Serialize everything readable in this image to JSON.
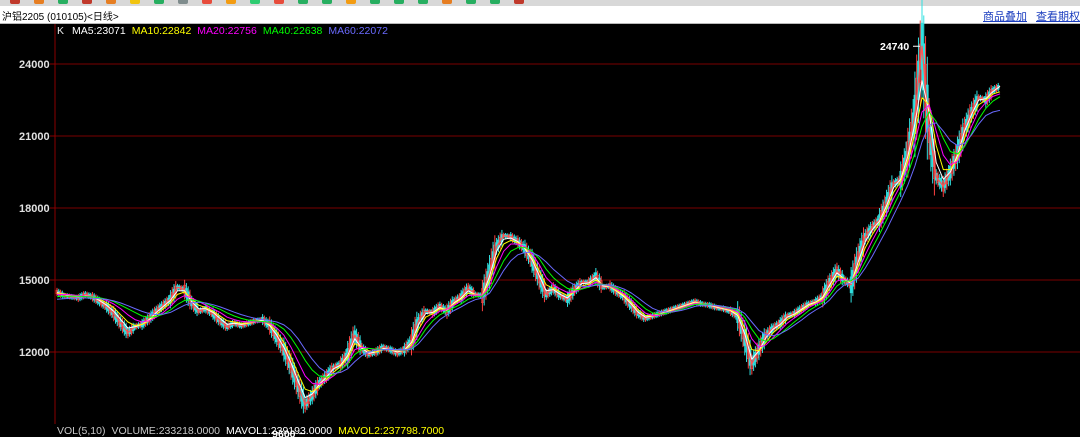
{
  "window": {
    "title": "沪铝2205 (010105)<日线>",
    "links": [
      "商品叠加",
      "查看期权"
    ]
  },
  "toolbar": {
    "icon_colors": [
      "#c0392b",
      "#e67e22",
      "#27ae60",
      "#c0392b",
      "#e67e22",
      "#f1c40f",
      "#27ae60",
      "#7f8c8d",
      "#e74c3c",
      "#f39c12",
      "#2ecc71",
      "#e74c3c",
      "#27ae60",
      "#27ae60",
      "#f39c12",
      "#27ae60",
      "#27ae60",
      "#27ae60",
      "#e67e22",
      "#27ae60",
      "#27ae60",
      "#c0392b"
    ]
  },
  "indicators": {
    "label": "K",
    "items": [
      {
        "text": "MA5:23071",
        "color": "#ffffff"
      },
      {
        "text": "MA10:22842",
        "color": "#ffff00"
      },
      {
        "text": "MA20:22756",
        "color": "#ff00ff"
      },
      {
        "text": "MA40:22638",
        "color": "#00ff00"
      },
      {
        "text": "MA60:22072",
        "color": "#6a6aff"
      }
    ]
  },
  "volume_indicators": {
    "items": [
      {
        "text": "VOL(5,10)",
        "color": "#c8c8c8"
      },
      {
        "text": "VOLUME:233218.0000",
        "color": "#c8c8c8"
      },
      {
        "text": "MAVOL1:239193.0000",
        "color": "#ffffff"
      },
      {
        "text": "MAVOL2:237798.7000",
        "color": "#ffff00"
      }
    ]
  },
  "chart_data": {
    "type": "line",
    "title": "",
    "xlabel": "",
    "ylabel": "",
    "ylim": [
      9000,
      25500
    ],
    "y_ticks": [
      12000,
      15000,
      18000,
      21000,
      24000
    ],
    "y_tick_labels": [
      "12000",
      "15000",
      "18000",
      "21000",
      "24000"
    ],
    "grid": true,
    "annotations": [
      {
        "text": "24740",
        "value": 24740,
        "position": "peak"
      },
      {
        "text": "9600",
        "value": 9600,
        "position": "low"
      }
    ],
    "series": [
      {
        "name": "K",
        "color": "#ff5555",
        "values": [
          14500,
          14350,
          14300,
          14250,
          14400,
          14300,
          14100,
          13900,
          13600,
          13200,
          12800,
          13050,
          13150,
          13400,
          13700,
          13950,
          14200,
          14700,
          14600,
          14050,
          13700,
          13800,
          13600,
          13300,
          13050,
          13200,
          13100,
          13200,
          13300,
          13350,
          13100,
          12600,
          12100,
          11400,
          10600,
          9800,
          10200,
          10700,
          11000,
          11350,
          11500,
          11900,
          12700,
          12150,
          11900,
          12000,
          12200,
          12100,
          11950,
          12100,
          12450,
          13300,
          13700,
          13650,
          13900,
          13700,
          14100,
          14300,
          14650,
          14400,
          14350,
          15300,
          16400,
          16850,
          16800,
          16600,
          16300,
          15800,
          15100,
          14400,
          14650,
          14350,
          14200,
          14600,
          14900,
          14900,
          15150,
          14700,
          14750,
          14500,
          14300,
          13950,
          13600,
          13400,
          13500,
          13600,
          13700,
          13800,
          13900,
          14000,
          14100,
          14000,
          13950,
          13850,
          13800,
          13700,
          13500,
          12600,
          11500,
          12100,
          12700,
          13000,
          13200,
          13500,
          13600,
          13800,
          14000,
          14100,
          14300,
          14900,
          15400,
          15000,
          14800,
          15900,
          16800,
          17200,
          17500,
          18200,
          19000,
          19200,
          20300,
          21900,
          24740,
          21300,
          19300,
          18900,
          19500,
          20300,
          21300,
          22000,
          22600,
          22500,
          22900,
          23071
        ]
      },
      {
        "name": "MA5",
        "color": "#ffffff",
        "values": [
          14480,
          14400,
          14330,
          14300,
          14340,
          14300,
          14150,
          13950,
          13700,
          13350,
          13000,
          13050,
          13150,
          13350,
          13650,
          13900,
          14150,
          14550,
          14550,
          14100,
          13800,
          13800,
          13650,
          13400,
          13150,
          13200,
          13150,
          13200,
          13280,
          13320,
          13100,
          12700,
          12200,
          11550,
          10800,
          10100,
          10250,
          10650,
          10950,
          11300,
          11450,
          11850,
          12550,
          12150,
          11950,
          12000,
          12150,
          12100,
          12000,
          12080,
          12400,
          13150,
          13600,
          13650,
          13850,
          13750,
          14050,
          14250,
          14550,
          14400,
          14350,
          15150,
          16200,
          16700,
          16750,
          16600,
          16300,
          15850,
          15200,
          14550,
          14600,
          14400,
          14250,
          14550,
          14850,
          14880,
          15100,
          14750,
          14720,
          14520,
          14300,
          14000,
          13650,
          13450,
          13500,
          13580,
          13680,
          13780,
          13880,
          13980,
          14080,
          14000,
          13950,
          13870,
          13800,
          13720,
          13520,
          12750,
          11700,
          12050,
          12600,
          12950,
          13150,
          13450,
          13580,
          13780,
          13980,
          14080,
          14280,
          14800,
          15300,
          15050,
          14850,
          15750,
          16600,
          17100,
          17450,
          18100,
          18850,
          19200,
          20150,
          21500,
          23300,
          22000,
          19900,
          19200,
          19500,
          20200,
          21200,
          21900,
          22500,
          22550,
          22850,
          23071
        ]
      },
      {
        "name": "MA10",
        "color": "#ffff00",
        "values": [
          14450,
          14420,
          14370,
          14320,
          14320,
          14300,
          14200,
          14050,
          13850,
          13550,
          13250,
          13100,
          13150,
          13300,
          13550,
          13800,
          14050,
          14400,
          14500,
          14200,
          13950,
          13850,
          13700,
          13500,
          13300,
          13250,
          13200,
          13200,
          13250,
          13280,
          13150,
          12850,
          12400,
          11800,
          11100,
          10450,
          10350,
          10550,
          10850,
          11150,
          11400,
          11750,
          12350,
          12200,
          12050,
          12000,
          12100,
          12100,
          12050,
          12050,
          12300,
          12950,
          13450,
          13600,
          13800,
          13780,
          14000,
          14200,
          14450,
          14400,
          14350,
          14950,
          15900,
          16500,
          16650,
          16550,
          16350,
          15950,
          15400,
          14800,
          14650,
          14500,
          14350,
          14500,
          14750,
          14820,
          15000,
          14800,
          14720,
          14550,
          14350,
          14080,
          13750,
          13520,
          13500,
          13550,
          13650,
          13750,
          13850,
          13950,
          14050,
          14000,
          13960,
          13900,
          13820,
          13750,
          13600,
          13000,
          12100,
          12050,
          12400,
          12800,
          13050,
          13350,
          13520,
          13720,
          13920,
          14050,
          14220,
          14650,
          15150,
          15080,
          14900,
          15550,
          16350,
          16900,
          17350,
          17950,
          18650,
          19100,
          19950,
          21100,
          22600,
          22300,
          20600,
          19600,
          19600,
          20050,
          20900,
          21700,
          22300,
          22500,
          22750,
          22842
        ]
      },
      {
        "name": "MA20",
        "color": "#ff00ff",
        "values": [
          14400,
          14400,
          14380,
          14350,
          14330,
          14300,
          14250,
          14150,
          14000,
          13800,
          13550,
          13350,
          13250,
          13300,
          13450,
          13650,
          13900,
          14200,
          14350,
          14250,
          14100,
          13950,
          13800,
          13650,
          13450,
          13350,
          13280,
          13250,
          13250,
          13260,
          13200,
          13000,
          12700,
          12200,
          11600,
          11000,
          10700,
          10650,
          10800,
          11000,
          11250,
          11550,
          12100,
          12200,
          12150,
          12080,
          12100,
          12100,
          12080,
          12060,
          12200,
          12700,
          13200,
          13500,
          13700,
          13780,
          13950,
          14120,
          14350,
          14380,
          14360,
          14750,
          15550,
          16200,
          16500,
          16500,
          16380,
          16100,
          15650,
          15100,
          14800,
          14620,
          14480,
          14500,
          14650,
          14750,
          14900,
          14820,
          14750,
          14600,
          14420,
          14180,
          13880,
          13620,
          13520,
          13530,
          13620,
          13720,
          13820,
          13920,
          14020,
          14000,
          13970,
          13920,
          13850,
          13780,
          13680,
          13250,
          12550,
          12200,
          12300,
          12600,
          12900,
          13200,
          13420,
          13620,
          13850,
          14000,
          14150,
          14500,
          14950,
          15050,
          14950,
          15350,
          16050,
          16650,
          17200,
          17750,
          18400,
          18950,
          19700,
          20700,
          22000,
          22300,
          21200,
          20200,
          19800,
          19950,
          20600,
          21400,
          22050,
          22400,
          22650,
          22756
        ]
      },
      {
        "name": "MA40",
        "color": "#00ff00",
        "values": [
          14300,
          14320,
          14330,
          14320,
          14310,
          14290,
          14260,
          14200,
          14100,
          13950,
          13800,
          13650,
          13500,
          13450,
          13480,
          13580,
          13750,
          13980,
          14150,
          14180,
          14120,
          14020,
          13900,
          13780,
          13630,
          13500,
          13400,
          13330,
          13290,
          13270,
          13240,
          13150,
          12950,
          12600,
          12150,
          11650,
          11250,
          11000,
          10950,
          11050,
          11250,
          11500,
          11900,
          12100,
          12150,
          12120,
          12110,
          12100,
          12090,
          12070,
          12150,
          12500,
          12950,
          13300,
          13550,
          13700,
          13850,
          14000,
          14200,
          14300,
          14330,
          14600,
          15200,
          15800,
          16200,
          16350,
          16350,
          16200,
          15900,
          15450,
          15100,
          14850,
          14650,
          14580,
          14620,
          14700,
          14820,
          14820,
          14780,
          14670,
          14520,
          14320,
          14050,
          13800,
          13630,
          13570,
          13610,
          13690,
          13780,
          13880,
          13980,
          14000,
          13980,
          13940,
          13880,
          13820,
          13740,
          13450,
          12950,
          12550,
          12450,
          12550,
          12750,
          13000,
          13250,
          13480,
          13720,
          13900,
          14050,
          14350,
          14750,
          14950,
          14970,
          15200,
          15750,
          16350,
          16900,
          17500,
          18100,
          18700,
          19400,
          20300,
          21400,
          22000,
          21600,
          20900,
          20350,
          20250,
          20550,
          21100,
          21700,
          22150,
          22450,
          22638
        ]
      },
      {
        "name": "MA60",
        "color": "#6a6aff",
        "values": [
          14200,
          14220,
          14240,
          14250,
          14250,
          14240,
          14220,
          14190,
          14130,
          14040,
          13930,
          13810,
          13690,
          13600,
          13560,
          13580,
          13650,
          13800,
          13950,
          14050,
          14070,
          14040,
          13970,
          13880,
          13770,
          13660,
          13560,
          13470,
          13400,
          13350,
          13310,
          13250,
          13130,
          12900,
          12550,
          12100,
          11700,
          11350,
          11150,
          11100,
          11150,
          11300,
          11600,
          11850,
          12000,
          12080,
          12100,
          12110,
          12100,
          12090,
          12120,
          12350,
          12700,
          13050,
          13350,
          13550,
          13730,
          13880,
          14050,
          14180,
          14250,
          14450,
          14900,
          15400,
          15800,
          16050,
          16150,
          16150,
          16000,
          15750,
          15450,
          15200,
          14950,
          14800,
          14740,
          14730,
          14780,
          14800,
          14790,
          14730,
          14620,
          14460,
          14250,
          14020,
          13820,
          13700,
          13660,
          13680,
          13730,
          13810,
          13900,
          13950,
          13960,
          13940,
          13900,
          13850,
          13790,
          13600,
          13250,
          12900,
          12720,
          12680,
          12760,
          12920,
          13120,
          13330,
          13560,
          13750,
          13920,
          14180,
          14530,
          14780,
          14880,
          15080,
          15500,
          16000,
          16550,
          17100,
          17700,
          18300,
          18950,
          19750,
          20750,
          21450,
          21550,
          21200,
          20800,
          20600,
          20700,
          21050,
          21500,
          21850,
          22000,
          22072
        ]
      }
    ]
  }
}
